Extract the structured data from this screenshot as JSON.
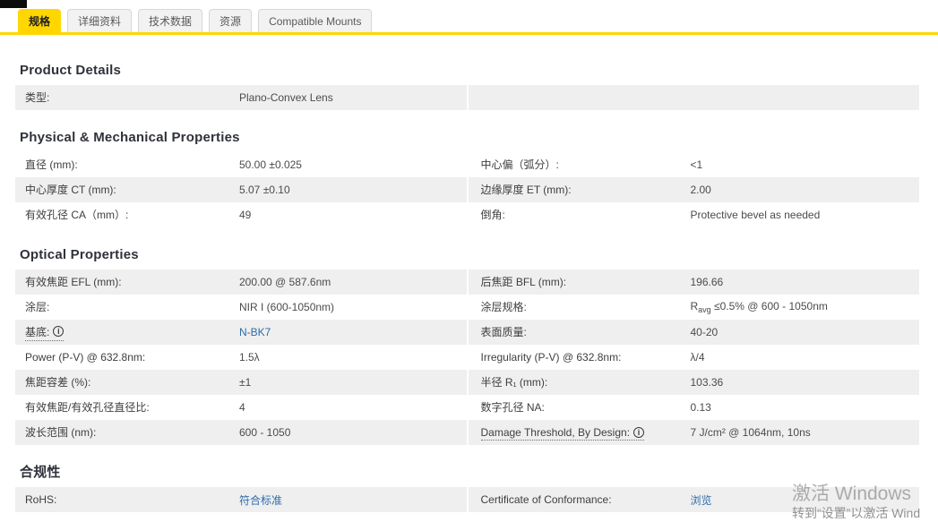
{
  "tabs": [
    {
      "label": "规格",
      "active": true
    },
    {
      "label": "详细资料",
      "active": false
    },
    {
      "label": "技术数据",
      "active": false
    },
    {
      "label": "资源",
      "active": false
    },
    {
      "label": "Compatible Mounts",
      "active": false
    }
  ],
  "colors": {
    "accent_yellow": "#ffd600",
    "row_gray": "#efefef",
    "link_blue": "#2e6cab",
    "heading_dark": "#2f323a"
  },
  "icons": {
    "info_glyph": "i"
  },
  "sections": {
    "product": {
      "title": "Product Details",
      "rows": [
        {
          "l_label": "类型:",
          "l_value": "Plano-Convex Lens"
        }
      ]
    },
    "physical": {
      "title": "Physical & Mechanical Properties",
      "rows": [
        {
          "l_label": "直径 (mm):",
          "l_value": "50.00 ±0.025",
          "r_label": "中心偏（弧分）:",
          "r_value": "<1"
        },
        {
          "l_label": "中心厚度 CT (mm):",
          "l_value": "5.07 ±0.10",
          "r_label": "边缘厚度 ET (mm):",
          "r_value": "2.00"
        },
        {
          "l_label": "有效孔径 CA（mm）:",
          "l_value": "49",
          "r_label": "倒角:",
          "r_value": "Protective bevel as needed"
        }
      ]
    },
    "optical": {
      "title": "Optical Properties",
      "rows": [
        {
          "l_label": "有效焦距 EFL (mm):",
          "l_value": "200.00 @ 587.6nm",
          "r_label": "后焦距 BFL (mm):",
          "r_value": "196.66"
        },
        {
          "l_label": "涂层:",
          "l_value": "NIR I (600-1050nm)",
          "r_label": "涂层规格:",
          "r_value_pre": "R",
          "r_value_sub": "avg",
          "r_value_post": " ≤0.5% @ 600 - 1050nm"
        },
        {
          "l_label": "基底:",
          "l_value_link": "N-BK7",
          "r_label": "表面质量:",
          "r_value": "40-20"
        },
        {
          "l_label": "Power (P-V) @ 632.8nm:",
          "l_value": "1.5λ",
          "r_label": "Irregularity (P-V) @ 632.8nm:",
          "r_value": "λ/4"
        },
        {
          "l_label": "焦距容差 (%):",
          "l_value": "±1",
          "r_label": "半径 R₁ (mm):",
          "r_value": "103.36"
        },
        {
          "l_label": "有效焦距/有效孔径直径比:",
          "l_value": "4",
          "r_label": "数字孔径 NA:",
          "r_value": "0.13"
        },
        {
          "l_label": "波长范围 (nm):",
          "l_value": "600 - 1050",
          "r_label": "Damage Threshold, By Design:",
          "r_value": "7 J/cm² @ 1064nm, 10ns"
        }
      ]
    },
    "compliance": {
      "title": "合规性",
      "rows": [
        {
          "l_label": "RoHS:",
          "l_value_link": "符合标准",
          "r_label": "Certificate of Conformance:",
          "r_value_link": "浏览"
        }
      ]
    }
  },
  "watermark": {
    "line1": "激活 Windows",
    "line2": "转到“设置”以激活 Wind"
  }
}
